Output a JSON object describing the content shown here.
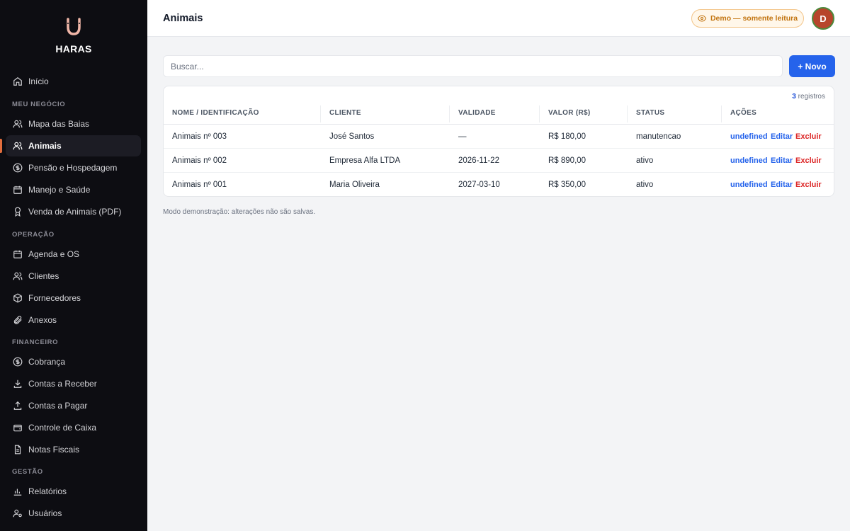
{
  "app": {
    "name": "HARAS"
  },
  "sidebar": {
    "top_items": [
      {
        "label": "Início",
        "icon": "home-icon"
      }
    ],
    "sections": [
      {
        "title": "MEU NEGÓCIO",
        "items": [
          {
            "label": "Mapa das Baias",
            "icon": "users-icon"
          },
          {
            "label": "Animais",
            "icon": "users-icon",
            "active": true
          },
          {
            "label": "Pensão e Hospedagem",
            "icon": "dollar-circle-icon"
          },
          {
            "label": "Manejo e Saúde",
            "icon": "calendar-icon"
          },
          {
            "label": "Venda de Animais (PDF)",
            "icon": "award-icon"
          }
        ]
      },
      {
        "title": "OPERAÇÃO",
        "items": [
          {
            "label": "Agenda e OS",
            "icon": "calendar-icon"
          },
          {
            "label": "Clientes",
            "icon": "users-icon"
          },
          {
            "label": "Fornecedores",
            "icon": "package-icon"
          },
          {
            "label": "Anexos",
            "icon": "paperclip-icon"
          }
        ]
      },
      {
        "title": "FINANCEIRO",
        "items": [
          {
            "label": "Cobrança",
            "icon": "dollar-circle-icon"
          },
          {
            "label": "Contas a Receber",
            "icon": "download-icon"
          },
          {
            "label": "Contas a Pagar",
            "icon": "upload-icon"
          },
          {
            "label": "Controle de Caixa",
            "icon": "wallet-icon"
          },
          {
            "label": "Notas Fiscais",
            "icon": "file-icon"
          }
        ]
      },
      {
        "title": "GESTÃO",
        "items": [
          {
            "label": "Relatórios",
            "icon": "bar-chart-icon"
          },
          {
            "label": "Usuários",
            "icon": "user-cog-icon"
          }
        ]
      }
    ]
  },
  "header": {
    "title": "Animais",
    "demo_badge": "Demo — somente leitura",
    "avatar_initial": "D"
  },
  "search": {
    "placeholder": "Buscar...",
    "value": ""
  },
  "new_button": "+ Novo",
  "table": {
    "count": "3",
    "count_label": "registros",
    "columns": [
      "NOME / IDENTIFICAÇÃO",
      "CLIENTE",
      "VALIDADE",
      "VALOR (R$)",
      "STATUS",
      "AÇÕES"
    ],
    "rows": [
      {
        "nome": "Animais nº 003",
        "cliente": "José Santos",
        "validade": "—",
        "valor": "R$ 180,00",
        "status": "manutencao"
      },
      {
        "nome": "Animais nº 002",
        "cliente": "Empresa Alfa LTDA",
        "validade": "2026-11-22",
        "valor": "R$ 890,00",
        "status": "ativo"
      },
      {
        "nome": "Animais nº 001",
        "cliente": "Maria Oliveira",
        "validade": "2027-03-10",
        "valor": "R$ 350,00",
        "status": "ativo"
      }
    ],
    "actions": {
      "view": "undefined",
      "edit": "Editar",
      "delete": "Excluir"
    }
  },
  "footnote": "Modo demonstração: alterações não são salvas.",
  "colors": {
    "sidebar_bg": "#0d0d12",
    "accent": "#2563eb",
    "active_bar": "#e26d3d",
    "danger": "#dc2626",
    "badge": "#c2740f"
  }
}
